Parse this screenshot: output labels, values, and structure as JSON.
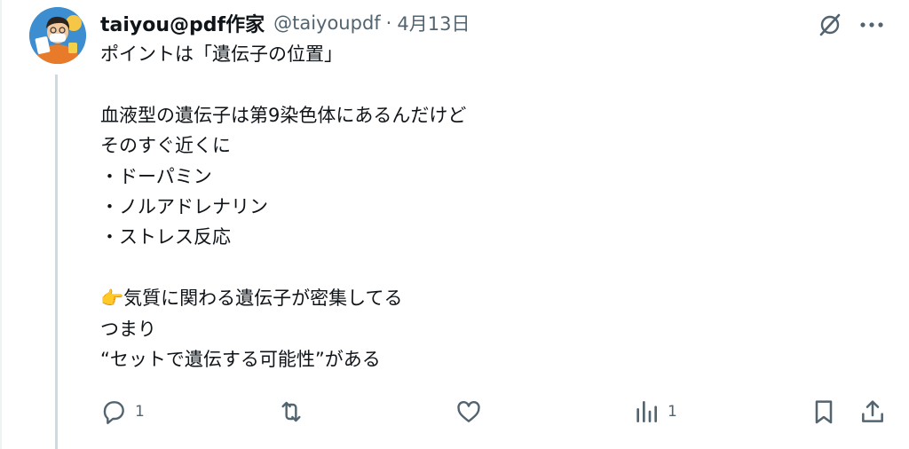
{
  "author": {
    "display_name": "taiyou@pdf作家",
    "handle": "@taiyoupdf",
    "separator": "·",
    "date": "4月13日"
  },
  "tweet": {
    "lines": [
      "ポイントは「遺伝子の位置」",
      "",
      "血液型の遺伝子は第9染色体にあるんだけど",
      "そのすぐ近くに",
      "・ドーパミン",
      "・ノルアドレナリン",
      "・ストレス反応",
      "",
      "👉気質に関わる遺伝子が密集してる",
      "つまり",
      "“セットで遺伝する可能性”がある"
    ]
  },
  "actions": {
    "reply_count": "1",
    "retweet_count": "",
    "like_count": "",
    "views_count": "1"
  },
  "icons": {
    "header": [
      "grok-icon",
      "more-icon"
    ],
    "actions": [
      "reply-icon",
      "retweet-icon",
      "like-icon",
      "views-icon",
      "bookmark-icon",
      "share-icon"
    ]
  },
  "colors": {
    "text": "#0f1419",
    "secondary": "#536471",
    "thread_line": "#cfd9de"
  }
}
